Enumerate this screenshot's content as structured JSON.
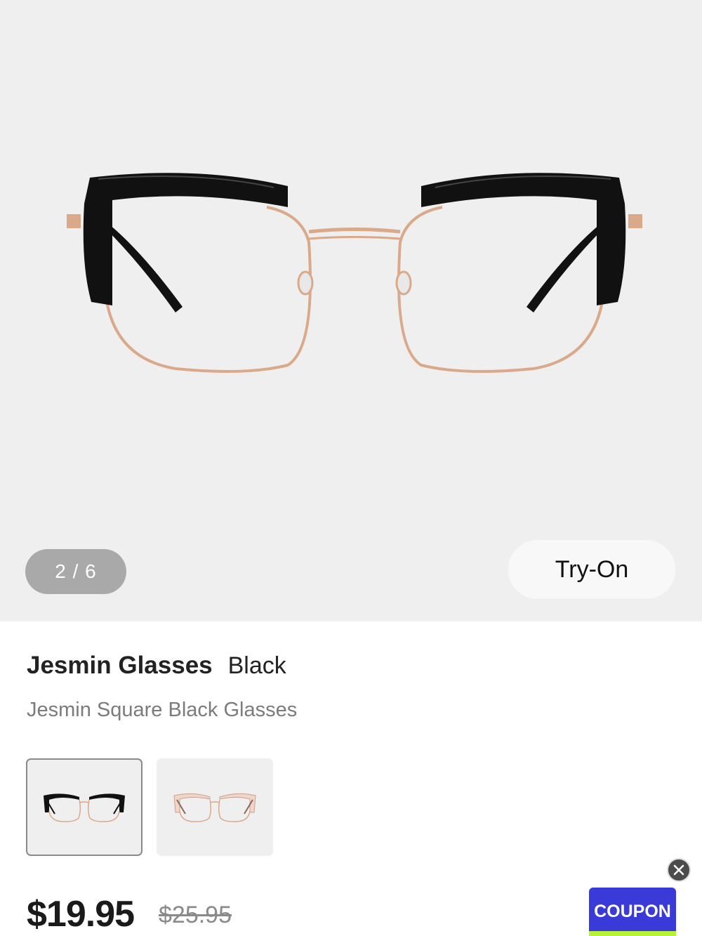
{
  "gallery": {
    "pager": "2 / 6",
    "try_on_label": "Try-On"
  },
  "product": {
    "name": "Jesmin Glasses",
    "color": "Black",
    "subtitle": "Jesmin Square Black Glasses",
    "swatches": [
      {
        "color": "black",
        "selected": true
      },
      {
        "color": "rose-gold",
        "selected": false
      }
    ],
    "price": "$19.95",
    "original_price": "$25.95"
  },
  "promo": {
    "coupon_label": "COUPON",
    "close_icon": "close-icon"
  },
  "colors": {
    "gallery_bg": "#efefef",
    "coupon_bg": "#3a3ad8",
    "coupon_accent": "#b6f236",
    "frame_black": "#111111",
    "frame_gold": "#d9a98a"
  }
}
